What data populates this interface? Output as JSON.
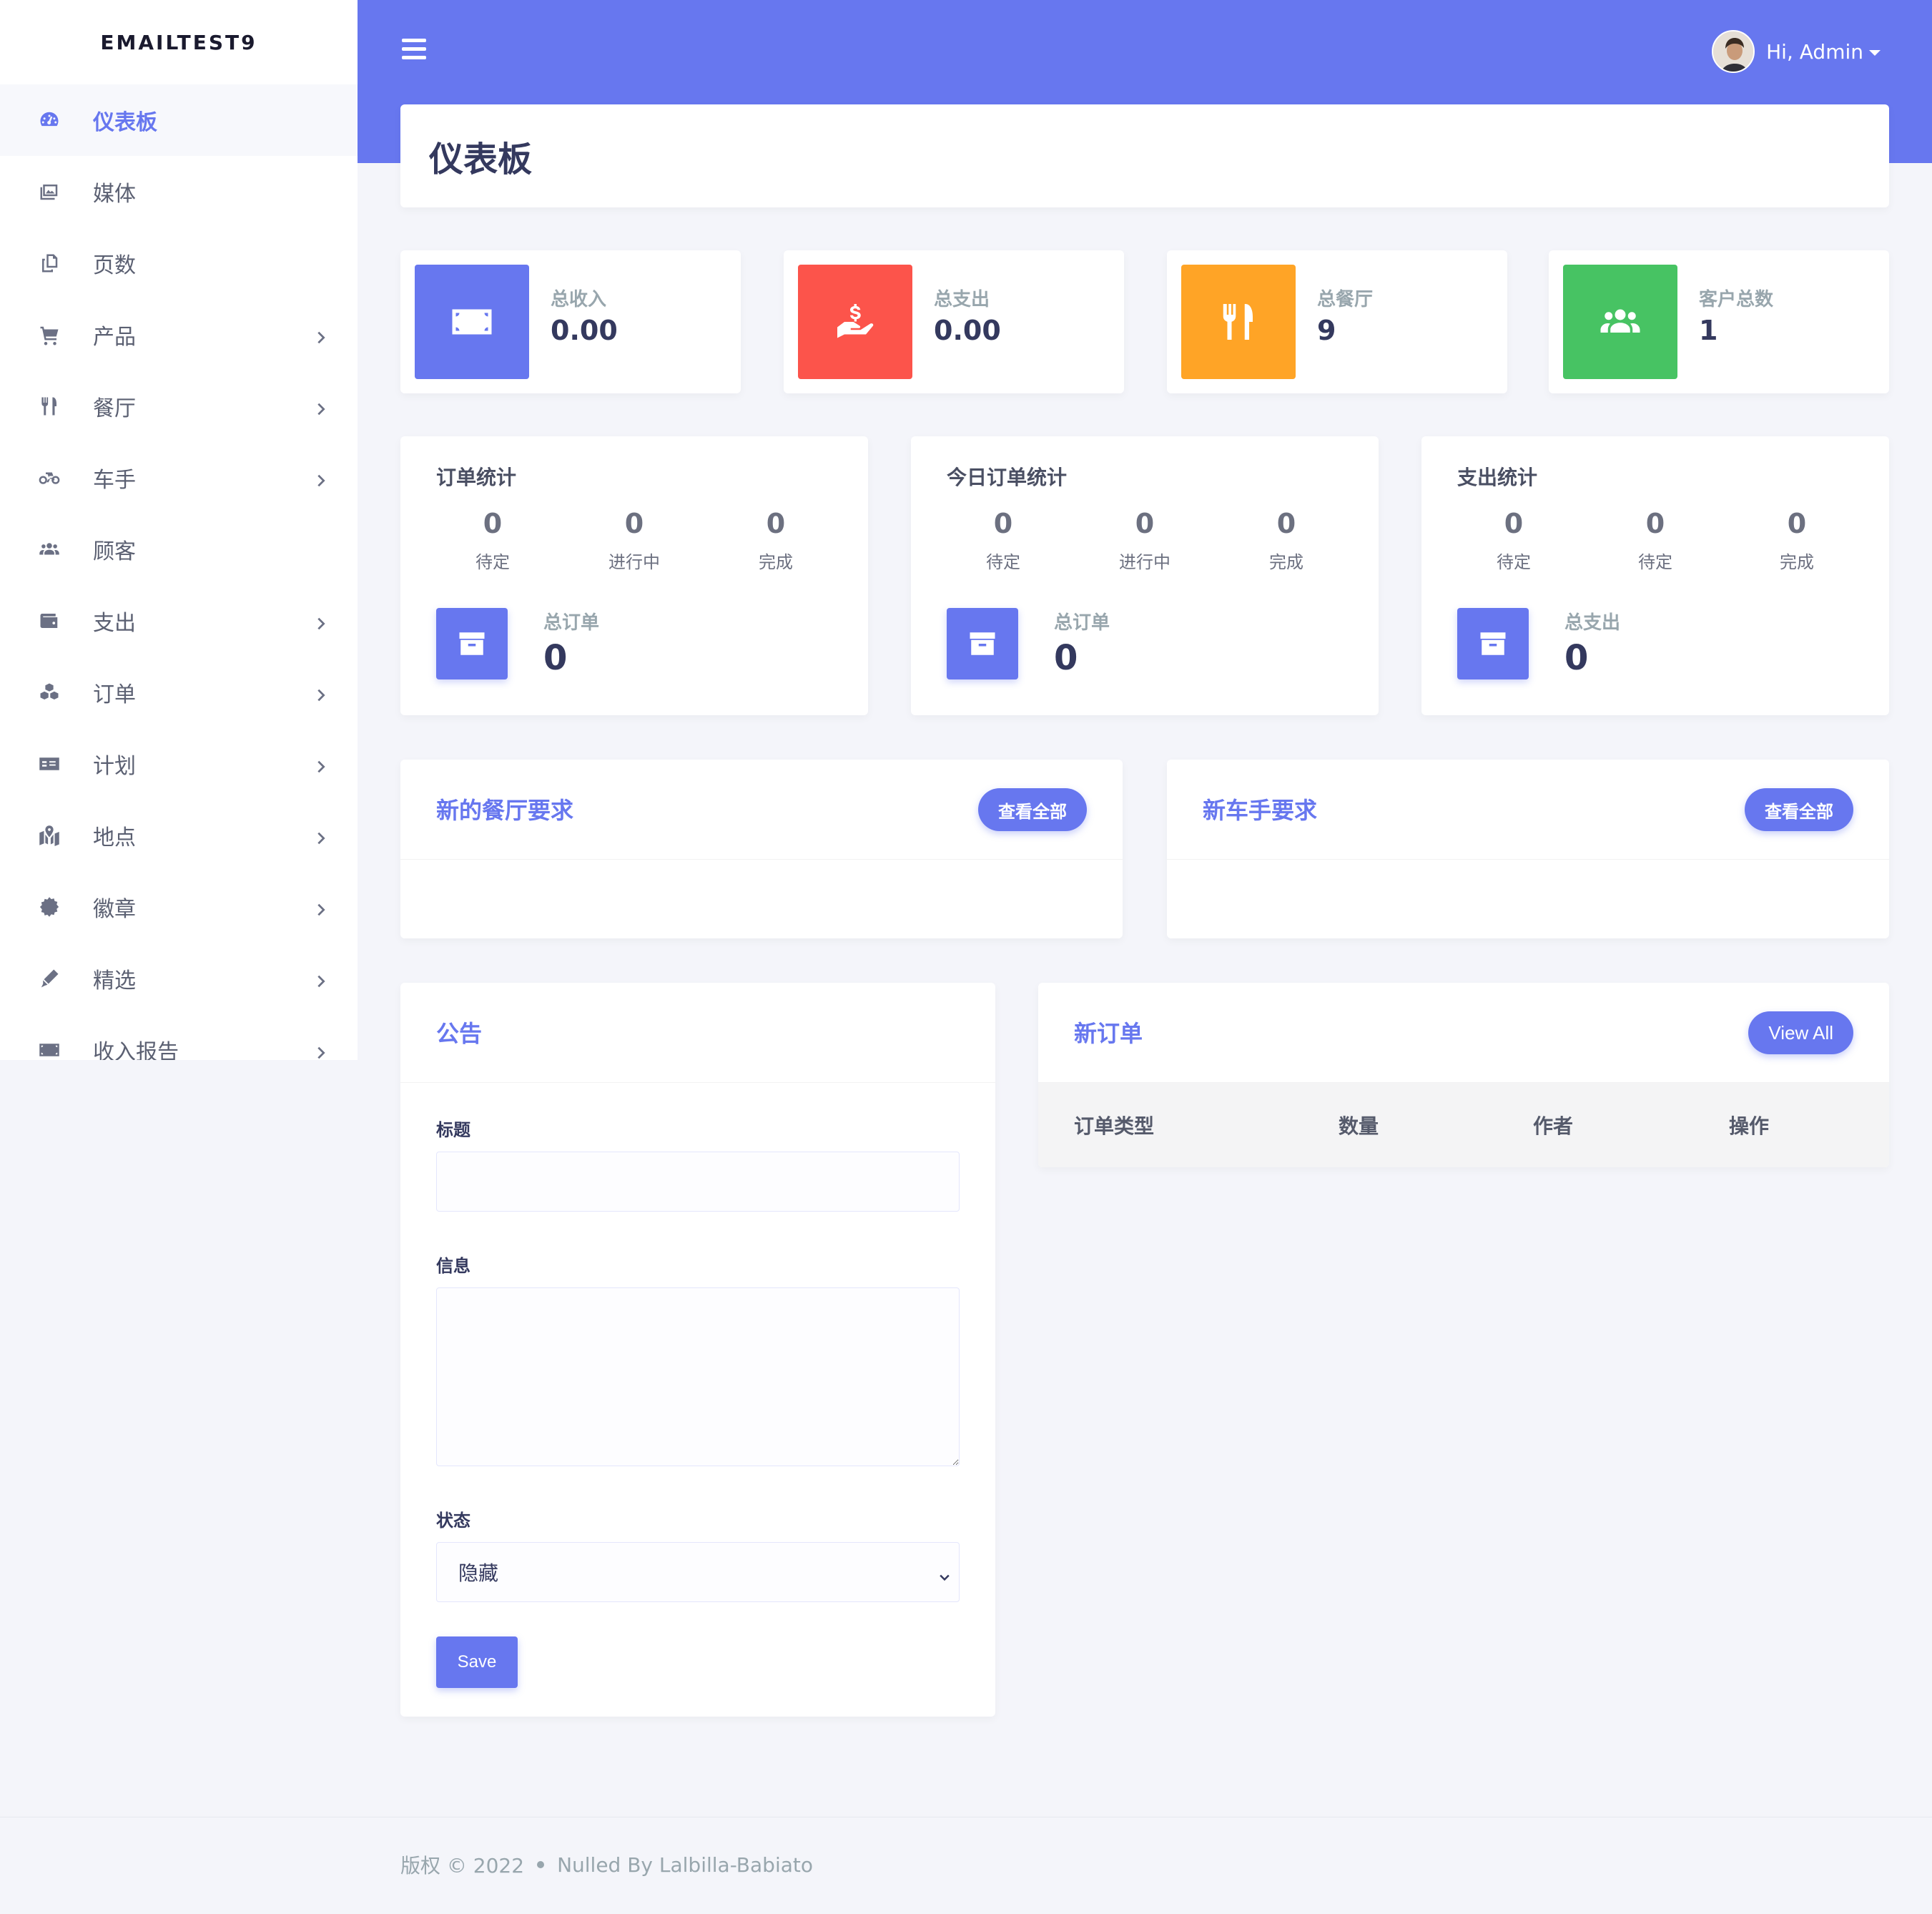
{
  "brand": "EMAILTEST9",
  "sidebar": {
    "items": [
      {
        "label": "仪表板",
        "icon": "dashboard-icon"
      },
      {
        "label": "媒体",
        "icon": "images-icon"
      },
      {
        "label": "页数",
        "icon": "copy-icon"
      },
      {
        "label": "产品",
        "icon": "cart-icon"
      },
      {
        "label": "餐厅",
        "icon": "utensils-icon"
      },
      {
        "label": "车手",
        "icon": "bicycle-icon"
      },
      {
        "label": "顾客",
        "icon": "users-icon"
      },
      {
        "label": "支出",
        "icon": "wallet-icon"
      },
      {
        "label": "订单",
        "icon": "cubes-icon"
      },
      {
        "label": "计划",
        "icon": "money-check-icon"
      },
      {
        "label": "地点",
        "icon": "map-marked-icon"
      },
      {
        "label": "徽章",
        "icon": "certificate-icon"
      },
      {
        "label": "精选",
        "icon": "pen-icon"
      },
      {
        "label": "收入报告",
        "icon": "money-bill-icon"
      }
    ]
  },
  "header": {
    "greeting": "Hi, Admin"
  },
  "page": {
    "title": "仪表板"
  },
  "stats": [
    {
      "label": "总收入",
      "value": "0.00",
      "color": "#6777ef",
      "icon": "money-bill-icon"
    },
    {
      "label": "总支出",
      "value": "0.00",
      "color": "#fc544b",
      "icon": "hand-holding-usd-icon"
    },
    {
      "label": "总餐厅",
      "value": "9",
      "color": "#ffa426",
      "icon": "utensils-icon"
    },
    {
      "label": "客户总数",
      "value": "1",
      "color": "#47c363",
      "icon": "users-icon"
    }
  ],
  "order_cards": [
    {
      "title": "订单统计",
      "items": [
        {
          "num": "0",
          "label": "待定"
        },
        {
          "num": "0",
          "label": "进行中"
        },
        {
          "num": "0",
          "label": "完成"
        }
      ],
      "total_label": "总订单",
      "total_value": "0"
    },
    {
      "title": "今日订单统计",
      "items": [
        {
          "num": "0",
          "label": "待定"
        },
        {
          "num": "0",
          "label": "进行中"
        },
        {
          "num": "0",
          "label": "完成"
        }
      ],
      "total_label": "总订单",
      "total_value": "0"
    },
    {
      "title": "支出统计",
      "items": [
        {
          "num": "0",
          "label": "待定"
        },
        {
          "num": "0",
          "label": "待定"
        },
        {
          "num": "0",
          "label": "完成"
        }
      ],
      "total_label": "总支出",
      "total_value": "0"
    }
  ],
  "requests": [
    {
      "title": "新的餐厅要求",
      "button": "查看全部"
    },
    {
      "title": "新车手要求",
      "button": "查看全部"
    }
  ],
  "notice": {
    "title": "公告",
    "title_label": "标题",
    "message_label": "信息",
    "status_label": "状态",
    "status_value": "隐藏",
    "save": "Save"
  },
  "new_orders": {
    "title": "新订单",
    "button": "View All",
    "columns": [
      "订单类型",
      "数量",
      "作者",
      "操作"
    ]
  },
  "footer": {
    "copyright": "版权 © 2022",
    "credit": "Nulled By Lalbilla-Babiato"
  }
}
